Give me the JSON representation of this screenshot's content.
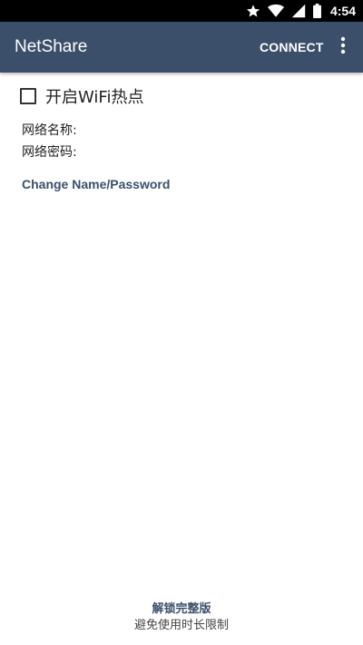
{
  "status_bar": {
    "time": "4:54",
    "icons": [
      "star-icon",
      "wifi-icon",
      "cellular-signal-icon",
      "battery-icon"
    ]
  },
  "app_bar": {
    "title": "NetShare",
    "connect_label": "CONNECT",
    "overflow_icon": "more-vert-icon",
    "background_color": "#3b4f6b"
  },
  "hotspot": {
    "label": "开启WiFi热点",
    "checked": false
  },
  "network_info": {
    "name_label": "网络名称:",
    "password_label": "网络密码:"
  },
  "change_link": {
    "label": "Change Name/Password"
  },
  "footer": {
    "unlock_title": "解锁完整版",
    "unlock_subtitle": "避免使用时长限制"
  }
}
